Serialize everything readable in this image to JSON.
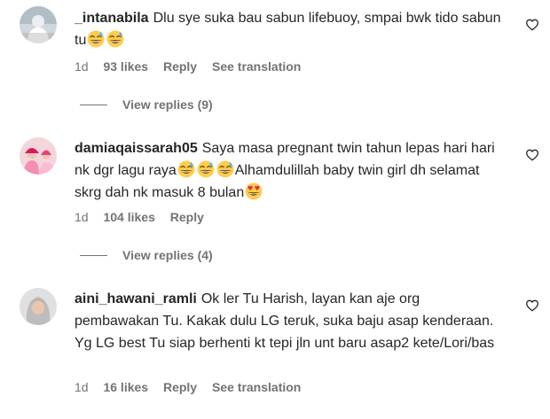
{
  "comments": [
    {
      "username": "_intanabila",
      "text": "Dlu sye suka bau sabun lifebuoy, smpai bwk tido sabun tu",
      "emojis": [
        "grinning-sweat-emoji",
        "grinning-sweat-emoji"
      ],
      "time": "1d",
      "likes": "93 likes",
      "reply": "Reply",
      "translate": "See translation",
      "view_replies": "View replies (9)"
    },
    {
      "username": "damiaqaissarah05",
      "text_part1": "Saya masa pregnant twin tahun lepas hari hari nk dgr lagu raya",
      "text_part2": "Alhamdulillah baby twin girl dh selamat skrg dah nk masuk 8 bulan",
      "emojis_mid": [
        "grinning-sweat-emoji",
        "grinning-sweat-emoji",
        "grinning-sweat-emoji"
      ],
      "emoji_end": "heart-eyes-emoji",
      "time": "1d",
      "likes": "104 likes",
      "reply": "Reply",
      "view_replies": "View replies (4)"
    },
    {
      "username": "aini_hawani_ramli",
      "text": "Ok ler Tu Harish, layan kan aje org pembawakan Tu. Kakak dulu LG teruk, suka baju asap kenderaan. Yg LG best Tu siap berhenti kt tepi jln unt baru asap2 kete/Lori/bas",
      "time": "1d",
      "likes": "16 likes",
      "reply": "Reply",
      "translate": "See translation"
    }
  ],
  "icons": {
    "like": "heart-outline-icon"
  },
  "colors": {
    "text": "#262626",
    "secondary": "#737373",
    "emoji_face": "#FFCC4D",
    "heart_red": "#DD2E44"
  }
}
